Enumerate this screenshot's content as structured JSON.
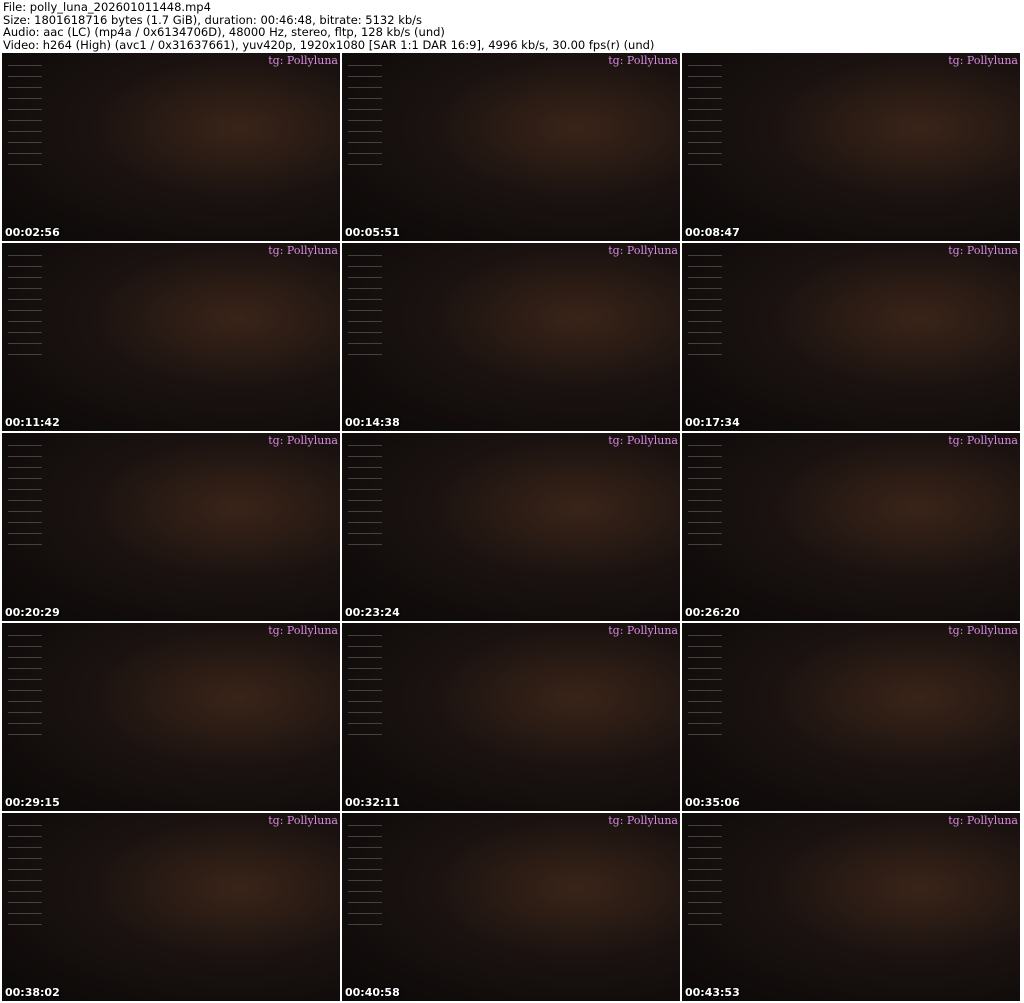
{
  "header": {
    "file": "File: polly_luna_202601011448.mp4",
    "size": "Size: 1801618716 bytes (1.7 GiB), duration: 00:46:48, bitrate: 5132 kb/s",
    "audio": "Audio: aac (LC) (mp4a / 0x6134706D), 48000 Hz, stereo, fltp, 128 kb/s (und)",
    "video": "Video: h264 (High) (avc1 / 0x31637661), yuv420p, 1920x1080 [SAR 1:1 DAR 16:9], 4996 kb/s, 30.00 fps(r) (und)"
  },
  "watermark": "tg: Pollyluna",
  "thumbnails": [
    {
      "time": "00:02:56"
    },
    {
      "time": "00:05:51"
    },
    {
      "time": "00:08:47"
    },
    {
      "time": "00:11:42"
    },
    {
      "time": "00:14:38"
    },
    {
      "time": "00:17:34"
    },
    {
      "time": "00:20:29"
    },
    {
      "time": "00:23:24"
    },
    {
      "time": "00:26:20"
    },
    {
      "time": "00:29:15"
    },
    {
      "time": "00:32:11"
    },
    {
      "time": "00:35:06"
    },
    {
      "time": "00:38:02"
    },
    {
      "time": "00:40:58"
    },
    {
      "time": "00:43:53"
    }
  ]
}
